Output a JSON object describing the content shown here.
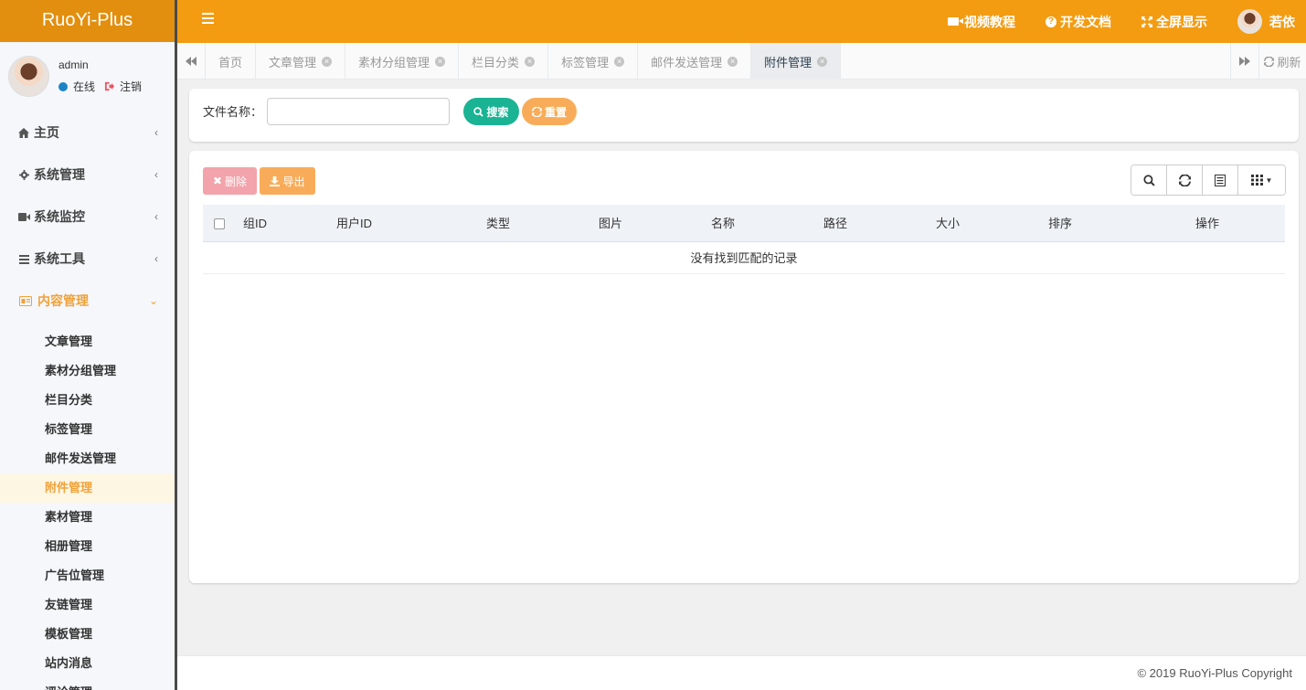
{
  "app": {
    "title": "RuoYi-Plus"
  },
  "user": {
    "name": "admin",
    "status": "在线",
    "logout": "注销",
    "header_name": "若依"
  },
  "header": {
    "links": [
      {
        "label": "视频教程",
        "icon": "video-icon"
      },
      {
        "label": "开发文档",
        "icon": "question-icon"
      },
      {
        "label": "全屏显示",
        "icon": "fullscreen-icon"
      }
    ]
  },
  "sidebar": {
    "items": [
      {
        "label": "主页",
        "icon": "home-icon"
      },
      {
        "label": "系统管理",
        "icon": "gear-icon"
      },
      {
        "label": "系统监控",
        "icon": "video-icon"
      },
      {
        "label": "系统工具",
        "icon": "bars-icon"
      },
      {
        "label": "内容管理",
        "icon": "id-card-icon",
        "active": true
      }
    ],
    "submenu": [
      "文章管理",
      "素材分组管理",
      "栏目分类",
      "标签管理",
      "邮件发送管理",
      "附件管理",
      "素材管理",
      "相册管理",
      "广告位管理",
      "友链管理",
      "模板管理",
      "站内消息",
      "评论管理"
    ],
    "active_submenu": "附件管理"
  },
  "tabs": {
    "items": [
      "首页",
      "文章管理",
      "素材分组管理",
      "栏目分类",
      "标签管理",
      "邮件发送管理",
      "附件管理"
    ],
    "active": "附件管理",
    "refresh": "刷新"
  },
  "search": {
    "label": "文件名称：",
    "value": "",
    "search_btn": "搜索",
    "reset_btn": "重置"
  },
  "table": {
    "delete_btn": "删除",
    "export_btn": "导出",
    "columns": [
      "组ID",
      "用户ID",
      "类型",
      "图片",
      "名称",
      "路径",
      "大小",
      "排序",
      "操作"
    ],
    "empty_text": "没有找到匹配的记录"
  },
  "footer": {
    "copyright": "© 2019 RuoYi-Plus Copyright"
  },
  "colors": {
    "header": "#f39c12",
    "logo": "#e28f0f",
    "accent": "#f0a23a",
    "primary": "#1ab394",
    "warning": "#f8ac59",
    "danger_light": "#f2a3ab"
  }
}
